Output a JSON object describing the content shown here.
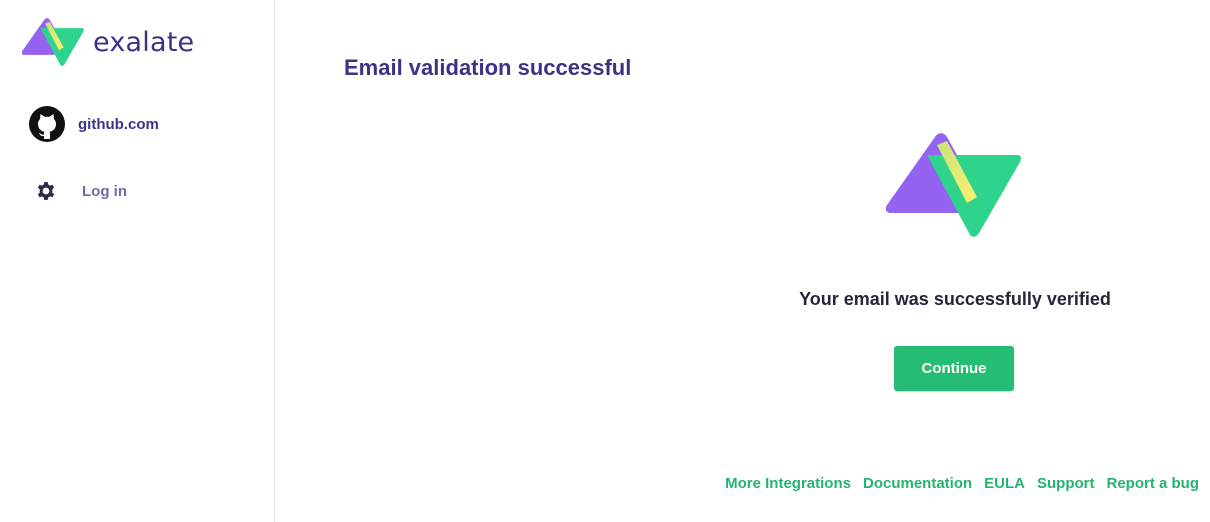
{
  "brand": {
    "name": "exalate",
    "colors": {
      "purple": "#9563f2",
      "green": "#2ed48b",
      "yellow": "#e9f47a"
    }
  },
  "sidebar": {
    "instance": {
      "label": "github.com",
      "icon": "github-icon"
    },
    "login": {
      "label": "Log in",
      "icon": "gear-icon"
    }
  },
  "main": {
    "title": "Email validation successful",
    "message": "Your email was successfully verified",
    "continue_label": "Continue"
  },
  "footer": {
    "links": [
      "More Integrations",
      "Documentation",
      "EULA",
      "Support",
      "Report a bug"
    ]
  },
  "colors": {
    "title": "#3b3486",
    "accent_green": "#24bd73",
    "link_green": "#24b46f"
  }
}
